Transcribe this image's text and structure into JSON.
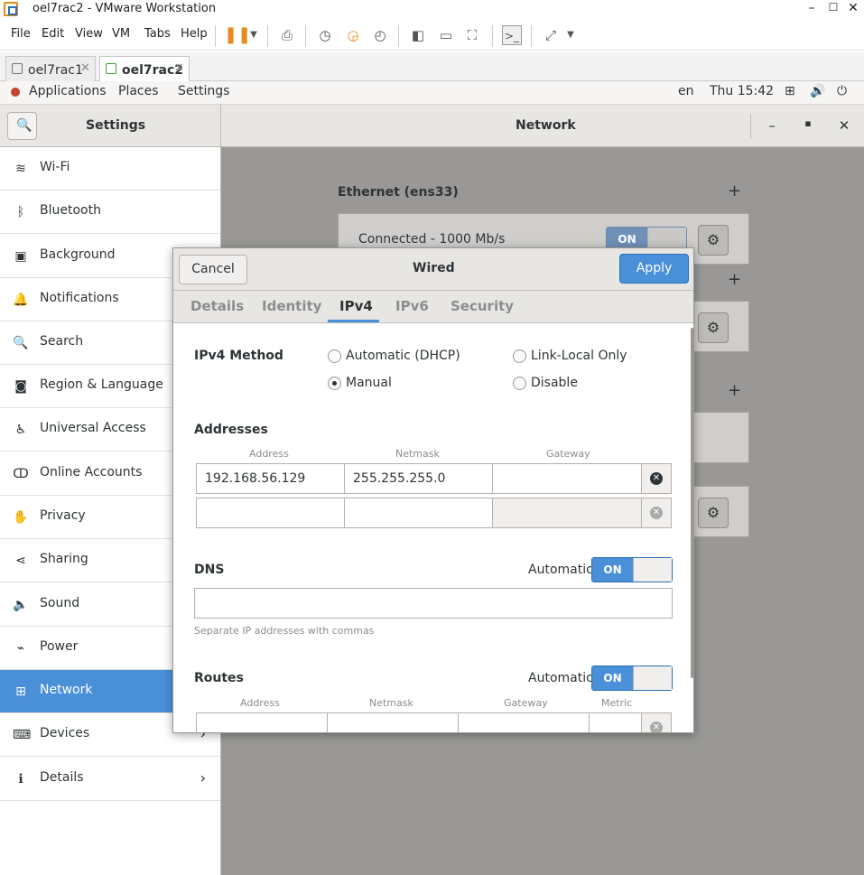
{
  "vmware": {
    "title": "oel7rac2 - VMware Workstation",
    "menus": [
      "File",
      "Edit",
      "View",
      "VM",
      "Tabs",
      "Help"
    ],
    "tabs": [
      {
        "label": "oel7rac1",
        "active": false
      },
      {
        "label": "oel7rac2",
        "active": true
      }
    ]
  },
  "gnome": {
    "applications": "Applications",
    "places": "Places",
    "settings": "Settings",
    "lang": "en",
    "clock": "Thu 15:42"
  },
  "settings": {
    "sidebar_title": "Settings",
    "panel_title": "Network",
    "items": [
      {
        "label": "Wi-Fi",
        "icon": "wifi-icon"
      },
      {
        "label": "Bluetooth",
        "icon": "bluetooth-icon"
      },
      {
        "label": "Background",
        "icon": "background-icon"
      },
      {
        "label": "Notifications",
        "icon": "bell-icon"
      },
      {
        "label": "Search",
        "icon": "search-icon"
      },
      {
        "label": "Region & Language",
        "icon": "camera-icon"
      },
      {
        "label": "Universal Access",
        "icon": "accessibility-icon"
      },
      {
        "label": "Online Accounts",
        "icon": "online-accounts-icon"
      },
      {
        "label": "Privacy",
        "icon": "hand-icon"
      },
      {
        "label": "Sharing",
        "icon": "share-icon"
      },
      {
        "label": "Sound",
        "icon": "speaker-icon"
      },
      {
        "label": "Power",
        "icon": "power-plug-icon"
      },
      {
        "label": "Network",
        "icon": "network-icon"
      },
      {
        "label": "Devices",
        "icon": "devices-icon"
      },
      {
        "label": "Details",
        "icon": "info-icon"
      }
    ],
    "selected": "Network"
  },
  "network": {
    "ethernet_title": "Ethernet (ens33)",
    "ethernet_status": "Connected - 1000 Mb/s",
    "switch_on": "ON"
  },
  "dialog": {
    "title": "Wired",
    "cancel": "Cancel",
    "apply": "Apply",
    "tabs": [
      "Details",
      "Identity",
      "IPv4",
      "IPv6",
      "Security"
    ],
    "active_tab": "IPv4",
    "method_label": "IPv4 Method",
    "methods": {
      "dhcp": "Automatic (DHCP)",
      "link_local": "Link-Local Only",
      "manual": "Manual",
      "disable": "Disable"
    },
    "selected_method": "Manual",
    "addresses": {
      "title": "Addresses",
      "col_address": "Address",
      "col_netmask": "Netmask",
      "col_gateway": "Gateway",
      "rows": [
        {
          "address": "192.168.56.129",
          "netmask": "255.255.255.0",
          "gateway": ""
        },
        {
          "address": "",
          "netmask": "",
          "gateway": ""
        }
      ]
    },
    "dns": {
      "title": "DNS",
      "automatic": "Automatic",
      "switch": "ON",
      "value": "",
      "hint": "Separate IP addresses with commas"
    },
    "routes": {
      "title": "Routes",
      "automatic": "Automatic",
      "switch": "ON",
      "col_address": "Address",
      "col_netmask": "Netmask",
      "col_gateway": "Gateway",
      "col_metric": "Metric"
    }
  }
}
